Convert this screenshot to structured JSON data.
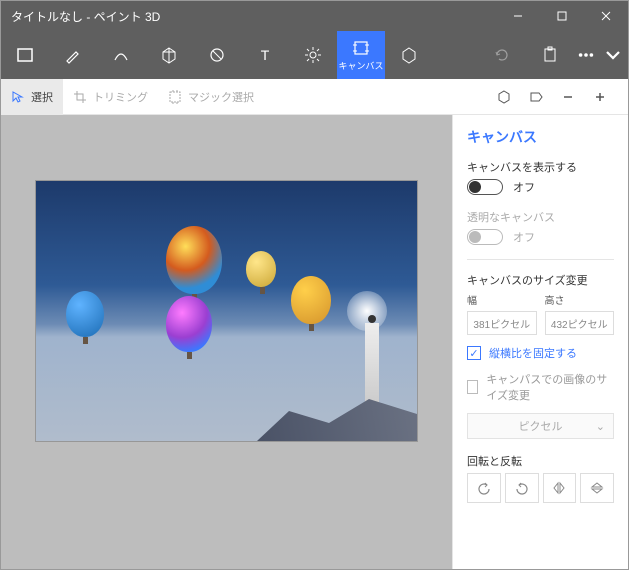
{
  "title": "タイトルなし - ペイント 3D",
  "ribbon": {
    "canvas_label": "キャンバス"
  },
  "toolbar": {
    "select": "選択",
    "trimming": "トリミング",
    "magic": "マジック選択"
  },
  "panel": {
    "title": "キャンバス",
    "show_canvas_label": "キャンバスを表示する",
    "show_canvas_state": "オフ",
    "transparent_label": "透明なキャンバス",
    "transparent_state": "オフ",
    "resize_section": "キャンバスのサイズ変更",
    "width_label": "幅",
    "height_label": "高さ",
    "width_value": "381ピクセル",
    "height_value": "432ピクセル",
    "lock_aspect": "縦横比を固定する",
    "resize_image": "キャンパスでの画像のサイズ変更",
    "unit": "ピクセル",
    "rotate_section": "回転と反転"
  }
}
